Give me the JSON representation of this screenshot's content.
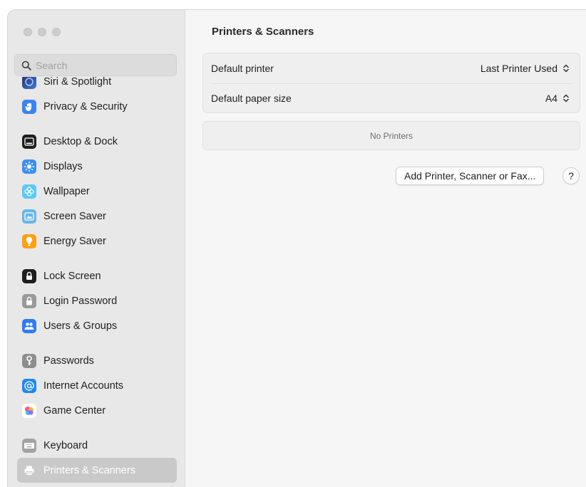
{
  "window": {
    "title": "Printers & Scanners"
  },
  "search": {
    "placeholder": "Search"
  },
  "sidebar": {
    "groups": [
      [
        {
          "label": "Siri & Spotlight",
          "icon": "siri-icon"
        },
        {
          "label": "Privacy & Security",
          "icon": "hand-icon"
        }
      ],
      [
        {
          "label": "Desktop & Dock",
          "icon": "dock-icon"
        },
        {
          "label": "Displays",
          "icon": "sun-icon"
        },
        {
          "label": "Wallpaper",
          "icon": "flower-icon"
        },
        {
          "label": "Screen Saver",
          "icon": "screen-saver-icon"
        },
        {
          "label": "Energy Saver",
          "icon": "bulb-icon"
        }
      ],
      [
        {
          "label": "Lock Screen",
          "icon": "lock-icon"
        },
        {
          "label": "Login Password",
          "icon": "padlock-icon"
        },
        {
          "label": "Users & Groups",
          "icon": "users-icon"
        }
      ],
      [
        {
          "label": "Passwords",
          "icon": "key-icon"
        },
        {
          "label": "Internet Accounts",
          "icon": "at-icon"
        },
        {
          "label": "Game Center",
          "icon": "game-center-icon"
        }
      ],
      [
        {
          "label": "Keyboard",
          "icon": "keyboard-icon"
        },
        {
          "label": "Printers & Scanners",
          "icon": "printer-icon",
          "selected": true
        }
      ]
    ]
  },
  "main": {
    "settings": {
      "default_printer_label": "Default printer",
      "default_printer_value": "Last Printer Used",
      "default_paper_label": "Default paper size",
      "default_paper_value": "A4"
    },
    "empty_state": "No Printers",
    "add_button": "Add Printer, Scanner or Fax...",
    "help_button": "?"
  },
  "colors": {
    "privacy": "#3b82f6",
    "displays": "#3a8ef6",
    "wallpaper": "#5ac8fa",
    "screen_saver": "#67b7e8",
    "energy": "#ff9f0a",
    "users": "#2f7bf5",
    "internet": "#1e88f5",
    "selection": "#c9c9c9"
  }
}
